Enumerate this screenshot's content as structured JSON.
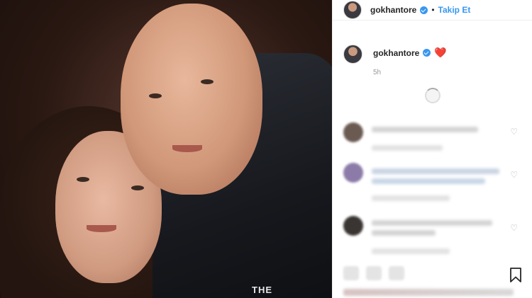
{
  "header": {
    "username": "gokhantore",
    "follow_label": "Takip Et",
    "separator": "•"
  },
  "caption": {
    "username": "gokhantore",
    "emoji": "❤️",
    "time": "5h"
  },
  "photo": {
    "jacket_logo": "THE"
  },
  "icons": {
    "verified": "verified-badge-icon",
    "heart": "heart-icon",
    "bookmark": "bookmark-icon",
    "spinner": "loading-spinner-icon"
  },
  "colors": {
    "verified_blue": "#3897f0",
    "follow_blue": "#3897f0",
    "heart_red": "#ed2939"
  }
}
